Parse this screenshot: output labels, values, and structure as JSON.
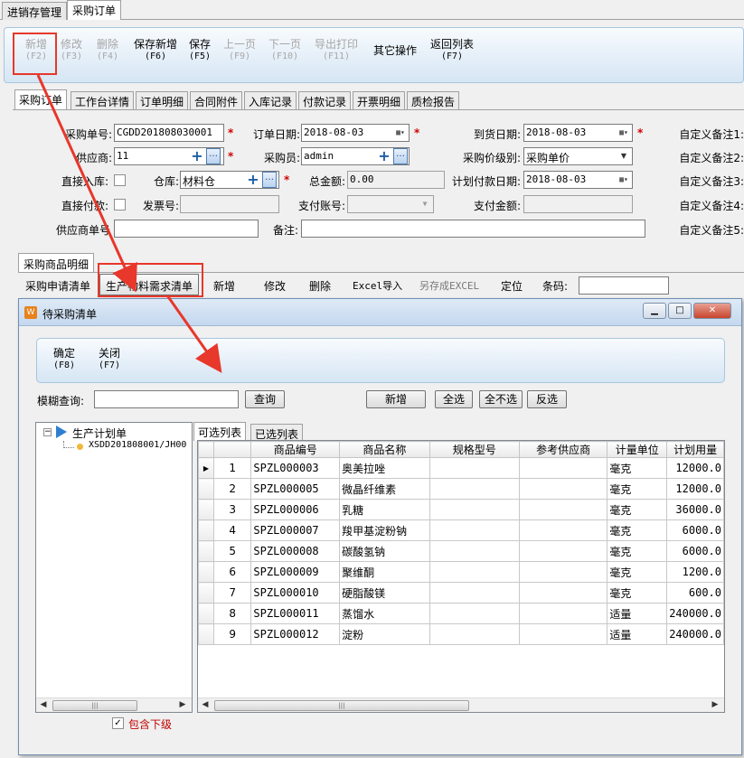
{
  "top_tabs": [
    "进销存管理",
    "采购订单"
  ],
  "toolbar": [
    {
      "label": "新增",
      "key": "(F2)",
      "enabled": false
    },
    {
      "label": "修改",
      "key": "(F3)",
      "enabled": false
    },
    {
      "label": "删除",
      "key": "(F4)",
      "enabled": false
    },
    {
      "label": "保存新增",
      "key": "(F6)",
      "enabled": true
    },
    {
      "label": "保存",
      "key": "(F5)",
      "enabled": true
    },
    {
      "label": "上一页",
      "key": "(F9)",
      "enabled": false
    },
    {
      "label": "下一页",
      "key": "(F10)",
      "enabled": false
    },
    {
      "label": "导出打印",
      "key": "(F11)",
      "enabled": false
    },
    {
      "label": "其它操作",
      "key": "",
      "enabled": true
    },
    {
      "label": "返回列表",
      "key": "(F7)",
      "enabled": true
    }
  ],
  "inner_tabs": [
    "采购订单",
    "工作台详情",
    "订单明细",
    "合同附件",
    "入库记录",
    "付款记录",
    "开票明细",
    "质检报告"
  ],
  "form": {
    "order_no_label": "采购单号:",
    "order_no": "CGDD201808030001",
    "order_date_label": "订单日期:",
    "order_date": "2018-08-03",
    "arrival_date_label": "到货日期:",
    "arrival_date": "2018-08-03",
    "custom1": "自定义备注1:",
    "supplier_label": "供应商:",
    "supplier": "11",
    "buyer_label": "采购员:",
    "buyer": "admin",
    "price_level_label": "采购价级别:",
    "price_level": "采购单价",
    "custom2": "自定义备注2:",
    "direct_in_label": "直接入库:",
    "warehouse_label": "仓库:",
    "warehouse": "材料仓",
    "total_label": "总金额:",
    "total": "0.00",
    "plan_pay_date_label": "计划付款日期:",
    "plan_pay_date": "2018-08-03",
    "custom3": "自定义备注3:",
    "direct_pay_label": "直接付款:",
    "invoice_label": "发票号:",
    "pay_account_label": "支付账号:",
    "pay_amount_label": "支付金额:",
    "custom4": "自定义备注4:",
    "supplier_order_label": "供应商单号",
    "remark_label": "备注:",
    "custom5": "自定义备注5:"
  },
  "detail": {
    "tab": "采购商品明细",
    "buttons": [
      "采购申请清单",
      "生产物料需求清单",
      "新增",
      "修改",
      "删除",
      "Excel导入",
      "另存成EXCEL",
      "定位"
    ],
    "barcode_label": "条码:"
  },
  "dialog": {
    "title": "待采购清单",
    "confirm": {
      "label": "确定",
      "key": "(F8)"
    },
    "close": {
      "label": "关闭",
      "key": "(F7)"
    },
    "search_label": "模糊查询:",
    "search_button": "查询",
    "add_button": "新增",
    "select_all": "全选",
    "select_none": "全不选",
    "invert": "反选",
    "tree_root": "生产计划单",
    "tree_child": "XSDD201808001/JH00",
    "tab_available": "可选列表",
    "tab_selected": "已选列表",
    "include_sub_label": "包含下级",
    "columns": [
      "商品编号",
      "商品名称",
      "规格型号",
      "参考供应商",
      "计量单位",
      "计划用量"
    ],
    "rows": [
      {
        "idx": "1",
        "code": "SPZL000003",
        "name": "奥美拉唑",
        "spec": "",
        "supplier": "",
        "unit": "毫克",
        "qty": "12000.0"
      },
      {
        "idx": "2",
        "code": "SPZL000005",
        "name": "微晶纤维素",
        "spec": "",
        "supplier": "",
        "unit": "毫克",
        "qty": "12000.0"
      },
      {
        "idx": "3",
        "code": "SPZL000006",
        "name": "乳糖",
        "spec": "",
        "supplier": "",
        "unit": "毫克",
        "qty": "36000.0"
      },
      {
        "idx": "4",
        "code": "SPZL000007",
        "name": "羧甲基淀粉钠",
        "spec": "",
        "supplier": "",
        "unit": "毫克",
        "qty": "6000.0"
      },
      {
        "idx": "5",
        "code": "SPZL000008",
        "name": "碳酸氢钠",
        "spec": "",
        "supplier": "",
        "unit": "毫克",
        "qty": "6000.0"
      },
      {
        "idx": "6",
        "code": "SPZL000009",
        "name": "聚维酮",
        "spec": "",
        "supplier": "",
        "unit": "毫克",
        "qty": "1200.0"
      },
      {
        "idx": "7",
        "code": "SPZL000010",
        "name": "硬脂酸镁",
        "spec": "",
        "supplier": "",
        "unit": "毫克",
        "qty": "600.0"
      },
      {
        "idx": "8",
        "code": "SPZL000011",
        "name": "蒸馏水",
        "spec": "",
        "supplier": "",
        "unit": "适量",
        "qty": "240000.0"
      },
      {
        "idx": "9",
        "code": "SPZL000012",
        "name": "淀粉",
        "spec": "",
        "supplier": "",
        "unit": "适量",
        "qty": "240000.0"
      }
    ]
  },
  "colors": {
    "accent": "#e8372b",
    "required": "#d00000"
  }
}
